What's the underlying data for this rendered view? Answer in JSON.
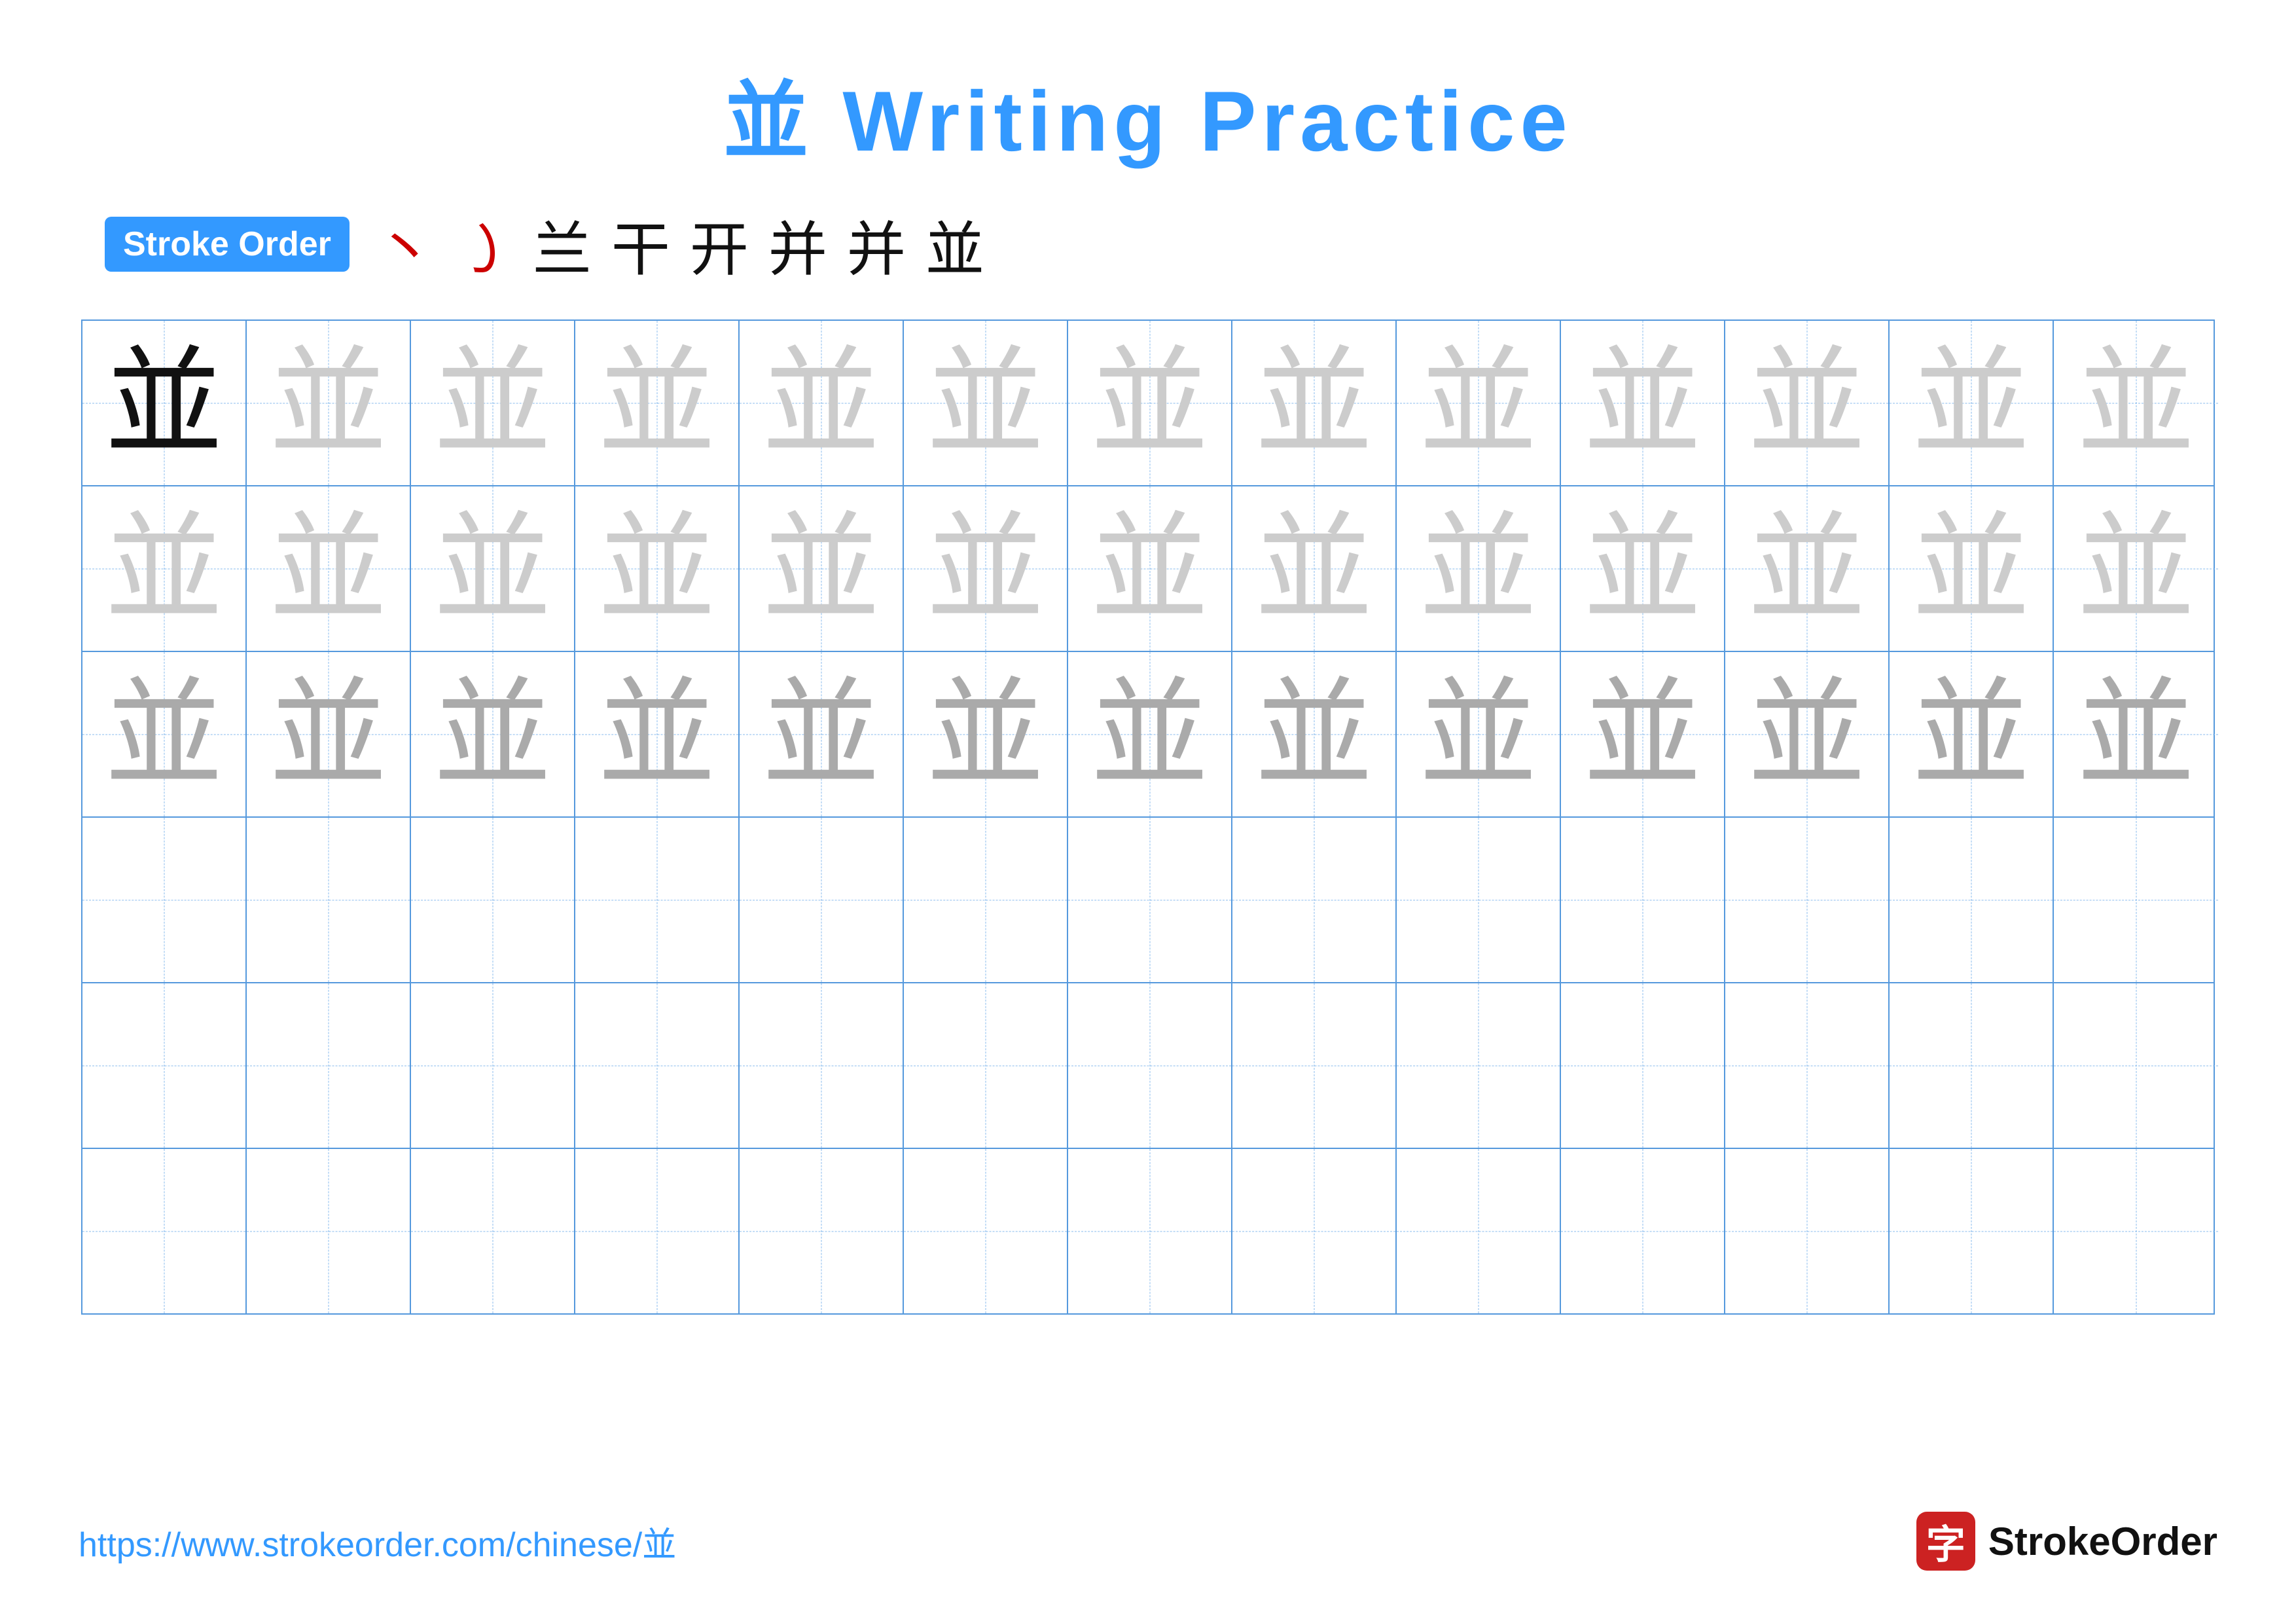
{
  "title": {
    "chinese_char": "並",
    "text": " Writing Practice"
  },
  "stroke_order": {
    "badge_label": "Stroke Order",
    "strokes": [
      "丶",
      "㇁",
      "兰",
      "干",
      "开",
      "并",
      "并",
      "並"
    ]
  },
  "grid": {
    "rows": 6,
    "cols": 13,
    "character": "並",
    "row_descriptions": [
      "dark_first_then_light",
      "all_light",
      "all_medium",
      "empty",
      "empty",
      "empty"
    ]
  },
  "footer": {
    "url": "https://www.strokeorder.com/chinese/並",
    "logo_text": "StrokeOrder",
    "logo_char": "字"
  }
}
